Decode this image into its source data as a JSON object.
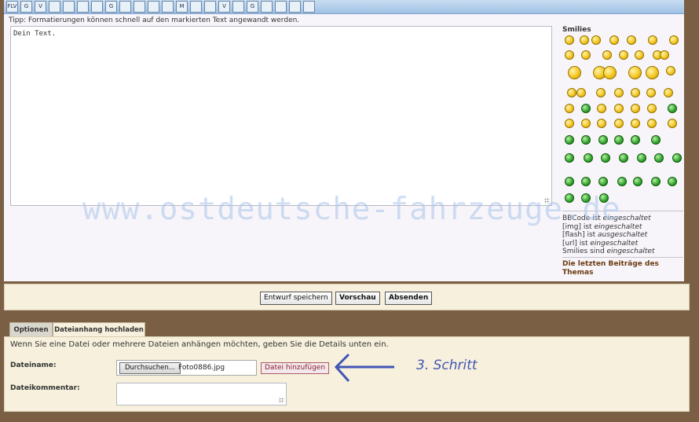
{
  "toolbar": {
    "icons": [
      "FLV",
      "G",
      "V",
      "",
      "",
      "",
      "",
      "G",
      "",
      "",
      "",
      "",
      "M",
      "",
      "",
      "V",
      "",
      "G",
      "",
      "",
      "",
      ""
    ]
  },
  "editor": {
    "tip": "Tipp: Formatierungen können schnell auf den markierten Text angewandt werden.",
    "text_value": "Dein Text."
  },
  "smilies": {
    "title": "Smilies"
  },
  "status": {
    "bbcode_prefix": "BBCode ist ",
    "bbcode_state": "eingeschaltet",
    "img_prefix": "[img] ist ",
    "img_state": "eingeschaltet",
    "flash_prefix": "[flash] ist ",
    "flash_state": "ausgeschaltet",
    "url_prefix": "[url] ist ",
    "url_state": "eingeschaltet",
    "smilies_prefix": "Smilies sind ",
    "smilies_state": "eingeschaltet"
  },
  "recent_posts_label": "Die letzten Beiträge des Themas",
  "watermark": "www.ostdeutsche-fahrzeuge.de",
  "actions": {
    "save_draft": "Entwurf speichern",
    "preview": "Vorschau",
    "submit": "Absenden"
  },
  "tabs": {
    "options": "Optionen",
    "attachments": "Dateianhang hochladen"
  },
  "upload": {
    "intro": "Wenn Sie eine Datei oder mehrere Dateien anhängen möchten, geben Sie die Details unten ein.",
    "filename_label": "Dateiname:",
    "browse_button": "Durchsuchen...",
    "file_value": "Foto0886.jpg",
    "add_file_button": "Datei hinzufügen",
    "comment_label": "Dateikommentar:"
  },
  "annotation": {
    "text": "3. Schritt",
    "color": "#4156b5"
  }
}
